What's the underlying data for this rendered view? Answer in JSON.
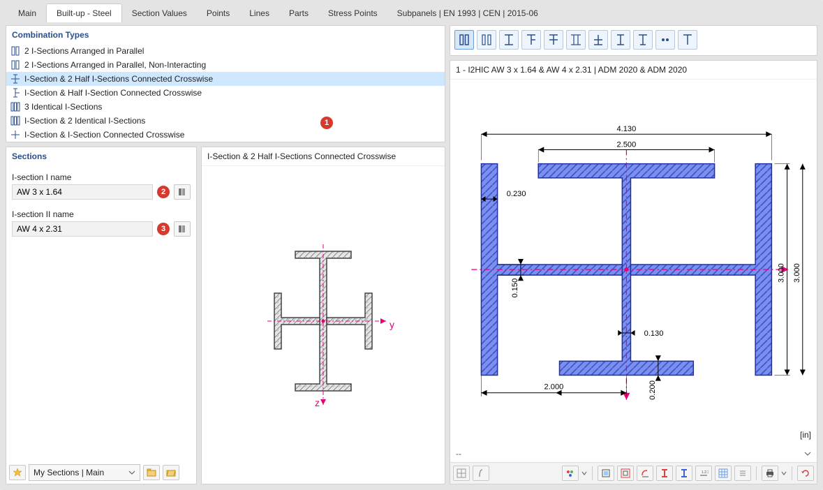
{
  "tabs": {
    "main": "Main",
    "builtup": "Built-up - Steel",
    "sectionvalues": "Section Values",
    "points": "Points",
    "lines": "Lines",
    "parts": "Parts",
    "stresspoints": "Stress Points",
    "subpanels": "Subpanels | EN 1993 | CEN | 2015-06"
  },
  "combination_types": {
    "title": "Combination Types",
    "items": [
      "2 I-Sections Arranged in Parallel",
      "2 I-Sections Arranged in Parallel, Non-Interacting",
      "I-Section & 2 Half I-Sections Connected Crosswise",
      "I-Section & Half I-Section Connected Crosswise",
      "3 Identical I-Sections",
      "I-Section & 2 Identical I-Sections",
      "I-Section & I-Section Connected Crosswise"
    ],
    "selected_index": 2
  },
  "sections": {
    "title": "Sections",
    "field1_label": "I-section I name",
    "field1_value": "AW 3 x 1.64",
    "field2_label": "I-section II name",
    "field2_value": "AW 4 x 2.31"
  },
  "preview": {
    "title": "I-Section & 2 Half I-Sections Connected Crosswise",
    "y_axis": "y",
    "z_axis": "z"
  },
  "bottom_select": {
    "value": "My Sections | Main"
  },
  "drawing": {
    "title": "1 - I2HIC AW 3 x 1.64 & AW 4 x 2.31 | ADM 2020 & ADM 2020",
    "unit": "[in]",
    "dims": {
      "d4130": "4.130",
      "d2500": "2.500",
      "d0230": "0.230",
      "d0150": "0.150",
      "d0130": "0.130",
      "d2000": "2.000",
      "d0200": "0.200",
      "d3000": "3.000",
      "d3000b": "3.000"
    }
  },
  "status": {
    "left": "--"
  },
  "callouts": {
    "c1": "1",
    "c2": "2",
    "c3": "3"
  }
}
